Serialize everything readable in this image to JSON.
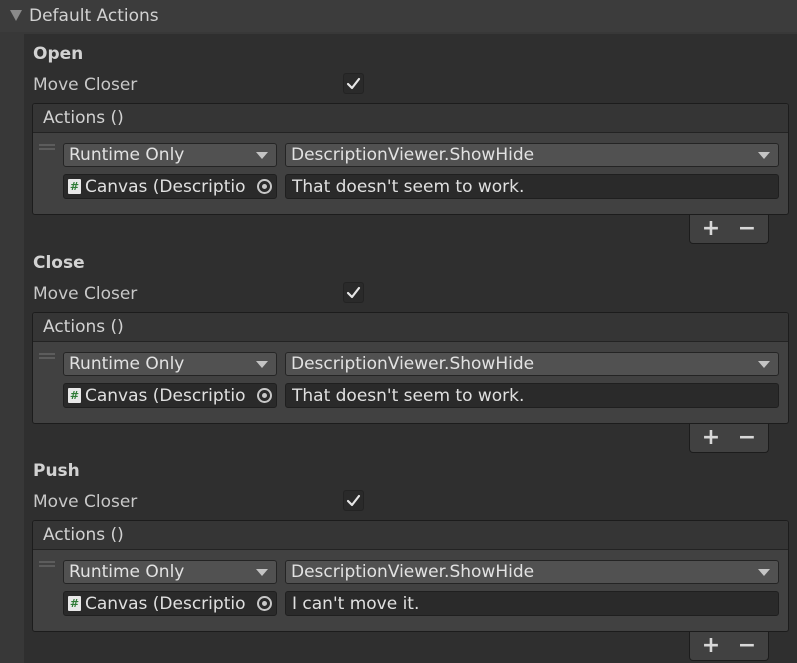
{
  "header": {
    "title": "Default Actions"
  },
  "sections": [
    {
      "title": "Open",
      "move_closer_label": "Move Closer",
      "move_closer_checked": true,
      "event_label": "Actions ()",
      "mode": "Runtime Only",
      "function": "DescriptionViewer.ShowHide",
      "target_object": "Canvas (Descriptio",
      "argument": "That doesn't seem to work.",
      "add_label": "+",
      "remove_label": "−"
    },
    {
      "title": "Close",
      "move_closer_label": "Move Closer",
      "move_closer_checked": true,
      "event_label": "Actions ()",
      "mode": "Runtime Only",
      "function": "DescriptionViewer.ShowHide",
      "target_object": "Canvas (Descriptio",
      "argument": "That doesn't seem to work.",
      "add_label": "+",
      "remove_label": "−"
    },
    {
      "title": "Push",
      "move_closer_label": "Move Closer",
      "move_closer_checked": true,
      "event_label": "Actions ()",
      "mode": "Runtime Only",
      "function": "DescriptionViewer.ShowHide",
      "target_object": "Canvas (Descriptio",
      "argument": "I can't move it.",
      "add_label": "+",
      "remove_label": "−"
    }
  ],
  "icons": {
    "foldout": "triangle-down-icon",
    "script": "script-icon",
    "picker": "object-picker-icon",
    "check": "checkmark-icon"
  },
  "colors": {
    "background": "#383838",
    "panel": "#2f2f2f",
    "event_body": "#414141",
    "field": "#2a2a2a",
    "dropdown": "#515151",
    "text": "#d2d2d2"
  }
}
